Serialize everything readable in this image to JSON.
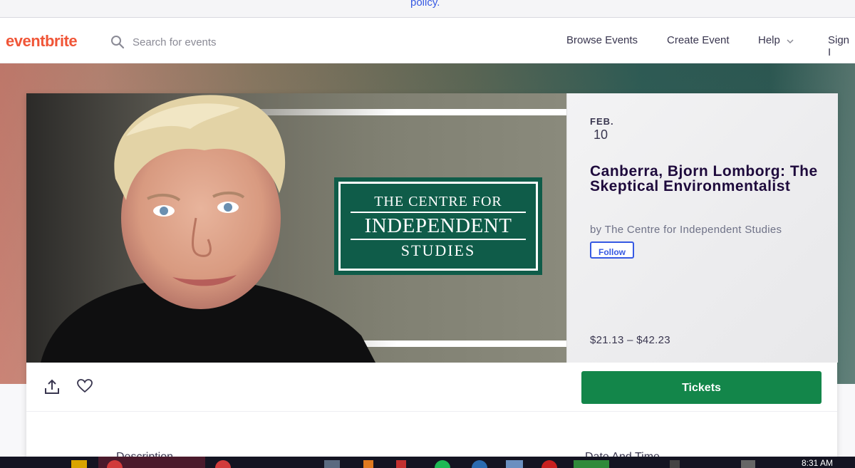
{
  "top_strip": {
    "policy_link": "policy."
  },
  "header": {
    "logo": "eventbrite",
    "search_placeholder": "Search for events",
    "nav": {
      "browse": "Browse Events",
      "create": "Create Event",
      "help": "Help",
      "signin": "Sign I"
    }
  },
  "event": {
    "month": "FEB.",
    "day": "10",
    "title": "Canberra, Bjorn Lomborg: The Skeptical Environmentalist",
    "organizer": "by The Centre for Independent Studies",
    "follow_label": "Follow",
    "price": "$21.13 – $42.23",
    "banner_logo": {
      "line1": "THE CENTRE FOR",
      "line2": "INDEPENDENT",
      "line3": "STUDIES"
    }
  },
  "actions": {
    "tickets_label": "Tickets"
  },
  "tabs": {
    "description": "Description",
    "date_time": "Date And Time"
  },
  "taskbar": {
    "clock": "8:31 AM"
  },
  "colors": {
    "brand": "#f05537",
    "tickets": "#13864a",
    "link": "#3659e3",
    "cis_green": "#0f5c49"
  }
}
